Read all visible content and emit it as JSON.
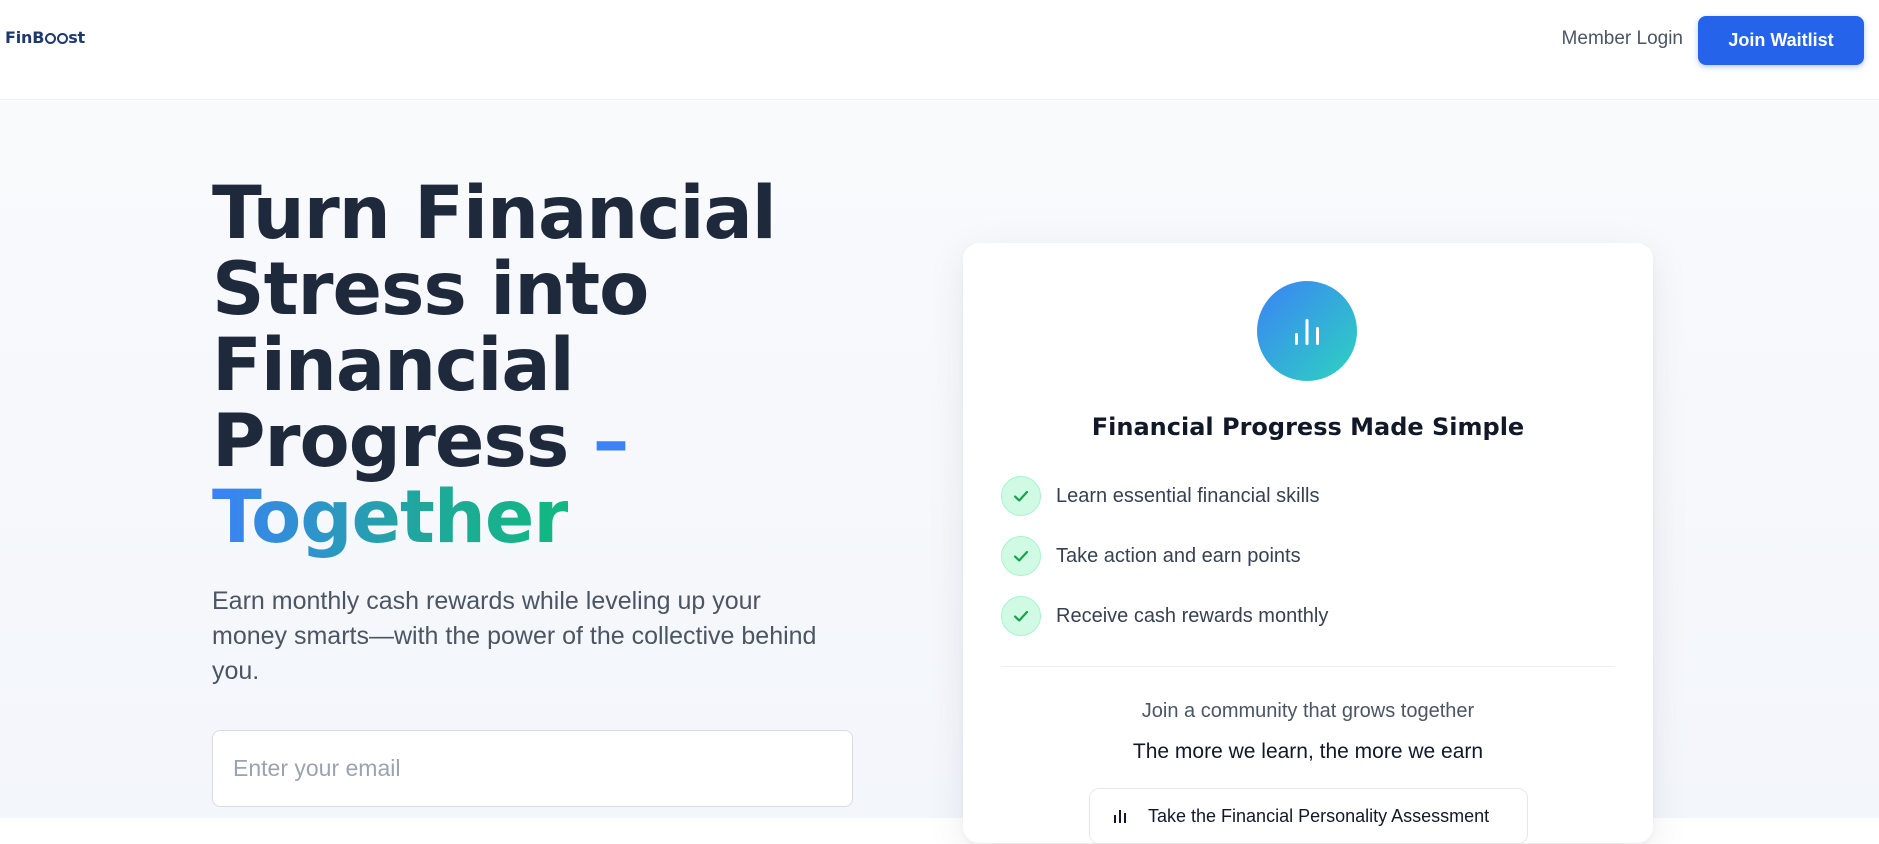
{
  "header": {
    "logo_prefix": "FinB",
    "logo_suffix": "st",
    "member_login_label": "Member Login",
    "join_waitlist_label": "Join Waitlist",
    "primary_color": "#2563eb"
  },
  "hero": {
    "headline_main": "Turn Financial Stress into Financial Progress",
    "headline_dash": "–",
    "headline_accent": "Together",
    "subtext": "Earn monthly cash rewards while leveling up your money smarts—with the power of the collective behind you.",
    "email_placeholder": "Enter your email",
    "email_value": ""
  },
  "card": {
    "icon": "bar-chart-icon",
    "title": "Financial Progress Made Simple",
    "features": [
      {
        "icon": "check-icon",
        "label": "Learn essential financial skills"
      },
      {
        "icon": "check-icon",
        "label": "Take action and earn points"
      },
      {
        "icon": "check-icon",
        "label": "Receive cash rewards monthly"
      }
    ],
    "community_text": "Join a community that grows together",
    "motto": "The more we learn, the more we earn",
    "assessment_button_label": "Take the Financial Personality Assessment",
    "accent_gradient": [
      "#3b82f6",
      "#2dd4bf"
    ],
    "check_color": "#16a34a"
  }
}
